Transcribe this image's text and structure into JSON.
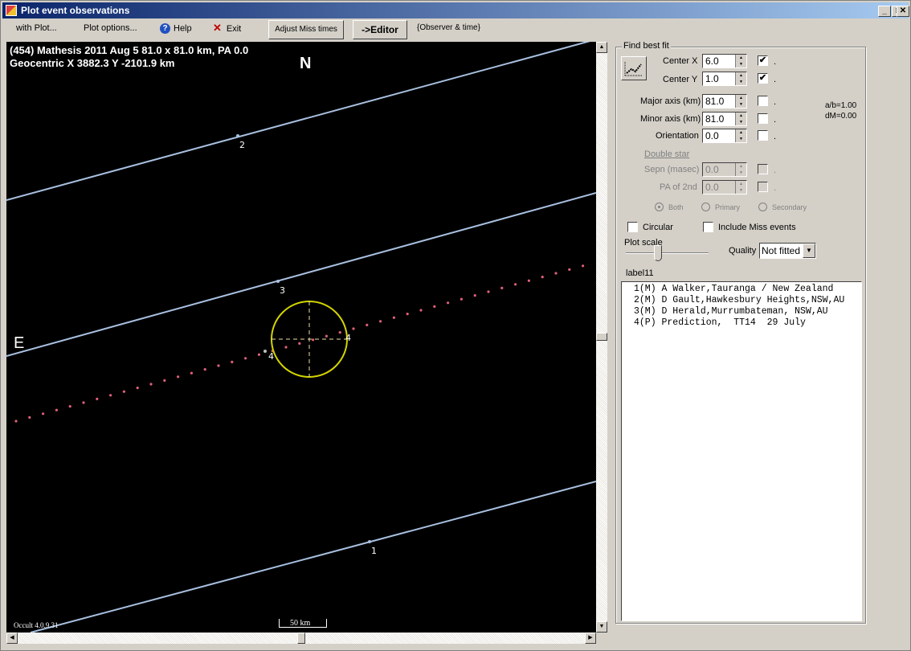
{
  "window": {
    "title": "Plot event observations",
    "controls": {
      "minimize": "_",
      "maximize": "□",
      "close": "✕"
    }
  },
  "menubar": {
    "with_plot": "with Plot...",
    "plot_options": "Plot options...",
    "help": "Help",
    "exit": "Exit",
    "adjust_miss_times": "Adjust Miss times",
    "editor": "->Editor",
    "observer_time": "{Observer & time}"
  },
  "plot": {
    "header_line1": "(454) Mathesis  2011 Aug 5   81.0 x 81.0 km, PA 0.0",
    "header_line2": "Geocentric X  3882.3  Y -2101.9 km",
    "north_label": "N",
    "east_label": "E",
    "version": "Occult 4.0.9.31",
    "scale_bar_label": "50 km",
    "chords": [
      {
        "id": "1",
        "label": "1"
      },
      {
        "id": "2",
        "label": "2"
      },
      {
        "id": "3",
        "label": "3"
      }
    ],
    "prediction_labels": [
      "4",
      "4"
    ],
    "colors": {
      "background": "#000000",
      "chord": "#a8c0e0",
      "ellipse": "#d4d400",
      "crosshair": "#f0e0a0",
      "prediction_dots": "#e0607a",
      "text": "#ffffff"
    }
  },
  "fit_panel": {
    "title": "Find best fit",
    "center_x": {
      "label": "Center X",
      "value": "6.0",
      "checked": true
    },
    "center_y": {
      "label": "Center Y",
      "value": "1.0",
      "checked": true
    },
    "major_axis": {
      "label": "Major axis (km)",
      "value": "81.0",
      "checked": false
    },
    "minor_axis": {
      "label": "Minor axis (km)",
      "value": "81.0",
      "checked": false
    },
    "orientation": {
      "label": "Orientation",
      "value": "0.0",
      "checked": false
    },
    "ratio_ab": "a/b=1.00",
    "dm": "dM=0.00",
    "double_star": "Double star",
    "sepn": {
      "label": "Sepn (masec)",
      "value": "0.0",
      "checked": false
    },
    "pa_2nd": {
      "label": "PA of 2nd",
      "value": "0.0",
      "checked": false
    },
    "radio_both": "Both",
    "radio_primary": "Primary",
    "radio_secondary": "Secondary",
    "circular": {
      "label": "Circular",
      "checked": false
    },
    "include_miss": {
      "label": "Include Miss events",
      "checked": false
    },
    "plot_scale": "Plot scale",
    "plot_scale_value": 0.4,
    "quality_label": "Quality",
    "quality_value": "Not fitted",
    "label11": "label11",
    "check_mark": "✔",
    "dot": "."
  },
  "observers": [
    "1(M) A Walker,Tauranga / New Zealand",
    "2(M) D Gault,Hawkesbury Heights,NSW,AU",
    "3(M) D Herald,Murrumbateman, NSW,AU",
    "4(P) Prediction,  TT14  29 July"
  ]
}
